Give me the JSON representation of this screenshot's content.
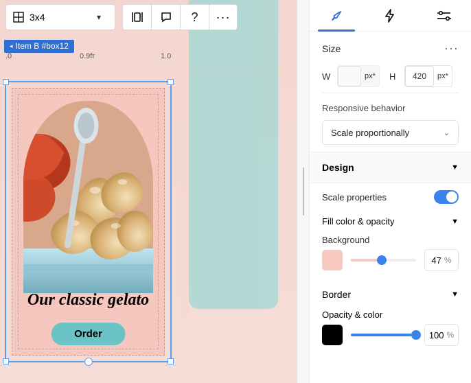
{
  "toolbar": {
    "grid_label": "3x4"
  },
  "tag": {
    "text": "Item B #box12"
  },
  "ruler": {
    "t0": ".0",
    "tmid": "0.9fr",
    "t1": "1.0"
  },
  "card": {
    "caption": "Our classic gelato",
    "order_label": "Order"
  },
  "panel": {
    "size": {
      "title": "Size",
      "w_label": "W",
      "h_label": "H",
      "w_unit": "px*",
      "h_value": "420",
      "h_unit": "px*"
    },
    "responsive": {
      "title": "Responsive behavior",
      "value": "Scale proportionally"
    },
    "design": {
      "title": "Design"
    },
    "scale_props": {
      "label": "Scale properties",
      "on": true
    },
    "fill": {
      "title": "Fill color & opacity"
    },
    "background": {
      "label": "Background",
      "swatch": "#f6c8c0",
      "value": "47",
      "unit": "%",
      "slider_pct": 47
    },
    "border": {
      "title": "Border"
    },
    "opacity": {
      "label": "Opacity & color",
      "swatch": "#000000",
      "value": "100",
      "unit": "%",
      "slider_pct": 100
    }
  }
}
